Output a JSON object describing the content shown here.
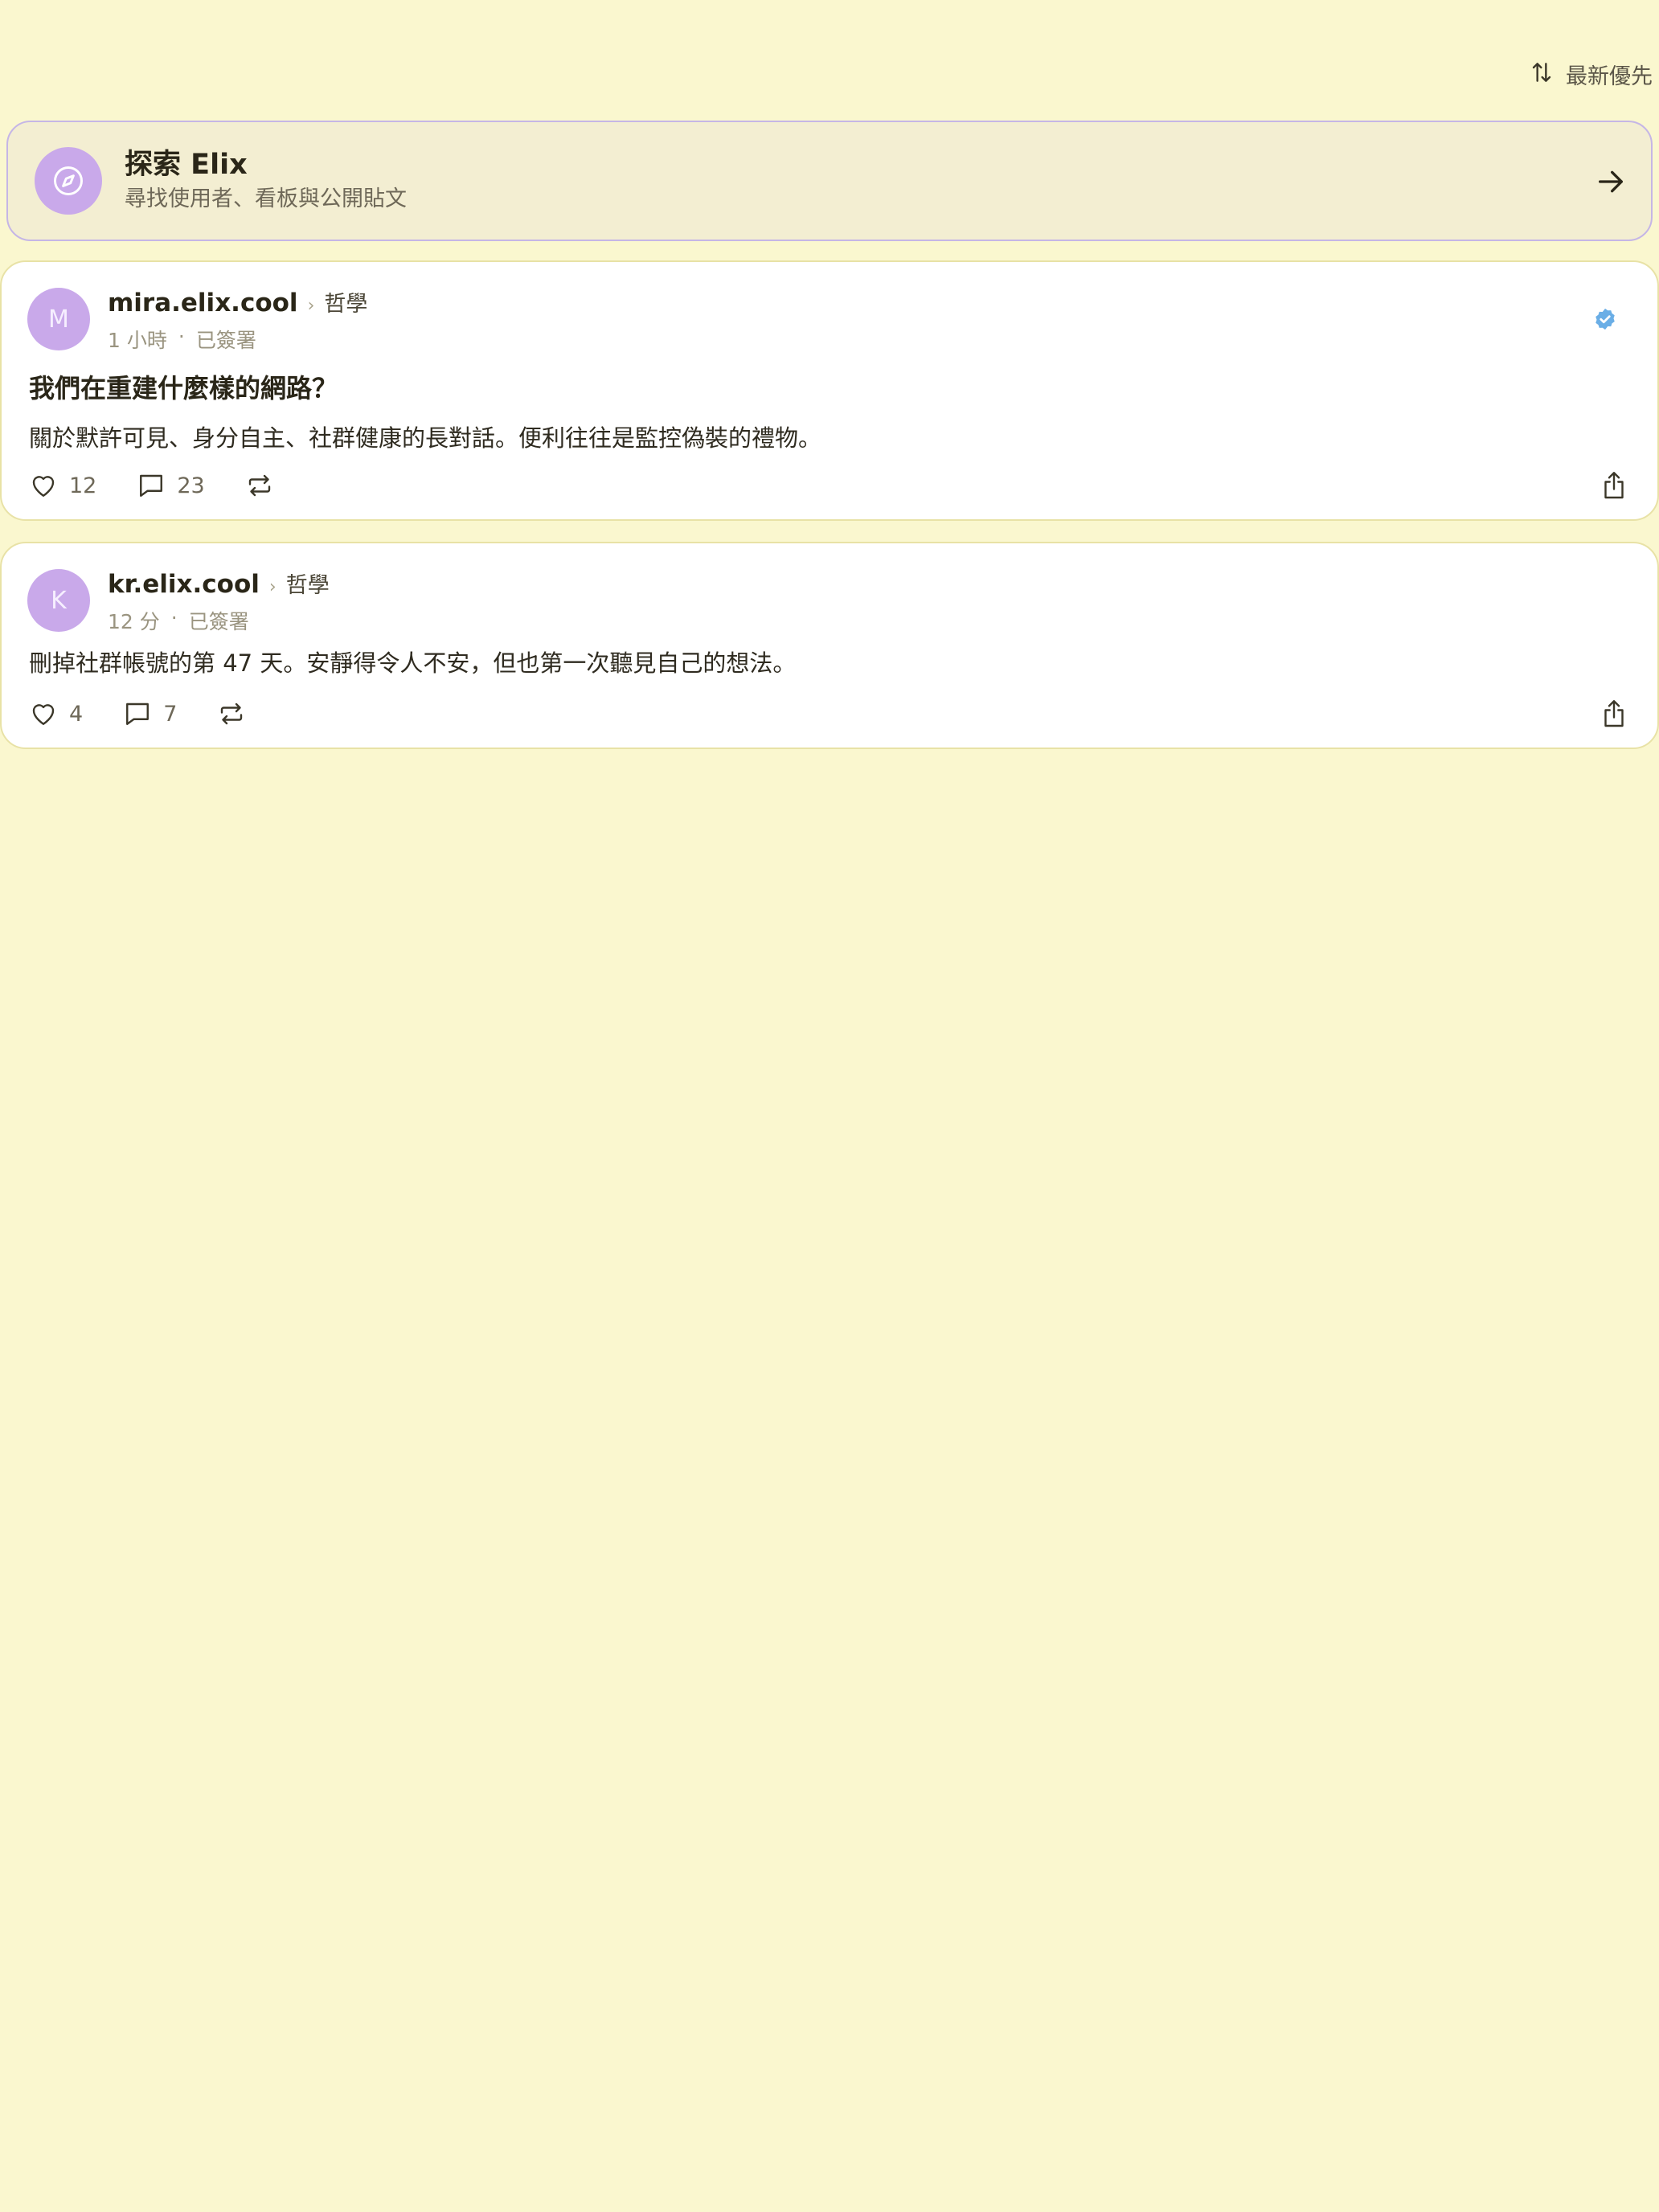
{
  "sort": {
    "icon": "sort-arrows-icon",
    "label": "最新優先"
  },
  "explore": {
    "icon": "compass-icon",
    "title": "探索 Elix",
    "subtitle": "尋找使用者、看板與公開貼文",
    "arrow_icon": "arrow-right-icon"
  },
  "posts": [
    {
      "avatar_letter": "M",
      "author": "mira.elix.cool",
      "board": "哲學",
      "time": "1 小時",
      "separator": "·",
      "signed": "已簽署",
      "verified": true,
      "title": "我們在重建什麼樣的網路？",
      "body": "關於默許可見、身分自主、社群健康的長對話。便利往往是監控偽裝的禮物。",
      "likes": "12",
      "comments": "23"
    },
    {
      "avatar_letter": "K",
      "author": "kr.elix.cool",
      "board": "哲學",
      "time": "12 分",
      "separator": "·",
      "signed": "已簽署",
      "verified": false,
      "title": "",
      "body": "刪掉社群帳號的第 47 天。安靜得令人不安，但也第一次聽見自己的想法。",
      "likes": "4",
      "comments": "7"
    }
  ],
  "colors": {
    "background": "#faf7cf",
    "avatar": "#c9a9ea",
    "verified": "#6aaee6",
    "explore_border": "#c5b6e6"
  }
}
